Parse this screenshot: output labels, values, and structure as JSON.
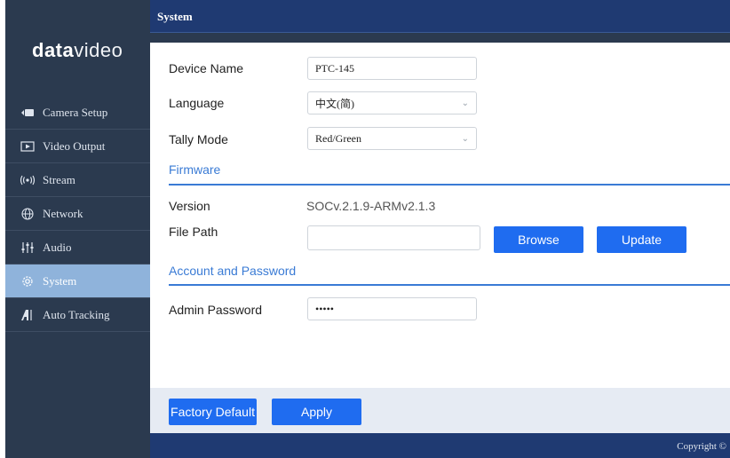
{
  "brand": {
    "bold": "data",
    "thin": "video"
  },
  "header": {
    "title": "System"
  },
  "nav": [
    {
      "label": "Camera Setup",
      "icon": "camera-icon",
      "glyph": "▶■"
    },
    {
      "label": "Video Output",
      "icon": "video-output-icon",
      "glyph": "⊳"
    },
    {
      "label": "Stream",
      "icon": "stream-icon",
      "glyph": "((•))"
    },
    {
      "label": "Network",
      "icon": "network-icon",
      "glyph": "⊕"
    },
    {
      "label": "Audio",
      "icon": "audio-icon",
      "glyph": "⫶"
    },
    {
      "label": "System",
      "icon": "gear-icon",
      "glyph": "⚙",
      "active": true
    },
    {
      "label": "Auto Tracking",
      "icon": "auto-tracking-icon",
      "glyph": "A"
    }
  ],
  "form": {
    "device_name_label": "Device Name",
    "device_name_value": "PTC-145",
    "language_label": "Language",
    "language_value": "中文(简)",
    "tally_label": "Tally Mode",
    "tally_value": "Red/Green"
  },
  "firmware": {
    "title": "Firmware",
    "version_label": "Version",
    "version_value": "SOCv.2.1.9-ARMv2.1.3",
    "file_path_label": "File Path",
    "file_path_value": "",
    "browse_label": "Browse",
    "update_label": "Update"
  },
  "account": {
    "title": "Account and Password",
    "admin_label": "Admin Password",
    "admin_value": "•••••"
  },
  "footer": {
    "factory_default_label": "Factory Default",
    "apply_label": "Apply",
    "copyright": "Copyright ©"
  },
  "colors": {
    "accent": "#1f6cf0",
    "sidebar": "#2b3a4f",
    "topbar": "#1f3a72",
    "active": "#8fb3db"
  }
}
